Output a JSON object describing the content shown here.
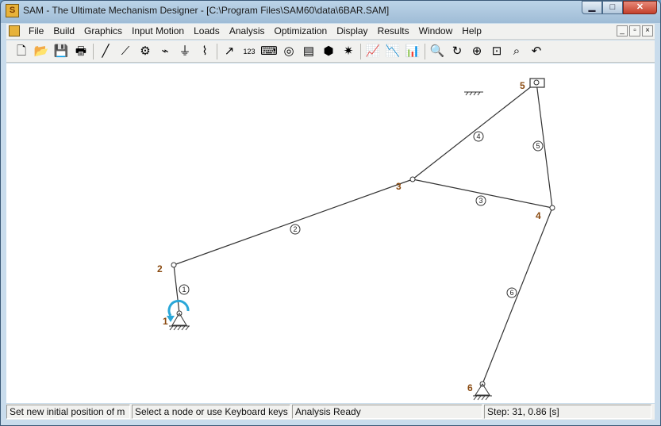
{
  "window": {
    "title": "SAM - The Ultimate Mechanism Designer - [C:\\Program Files\\SAM60\\data\\6BAR.SAM]",
    "app_icon": "sam-app-icon",
    "controls": {
      "minimize": "▁",
      "maximize": "□",
      "close": "✕"
    }
  },
  "menu": {
    "items": [
      "File",
      "Build",
      "Graphics",
      "Input Motion",
      "Loads",
      "Analysis",
      "Optimization",
      "Display",
      "Results",
      "Window",
      "Help"
    ],
    "mdi_controls": [
      "_",
      "▫",
      "×"
    ]
  },
  "toolbar": {
    "icons": [
      {
        "name": "new-icon",
        "glyph": "🗋"
      },
      {
        "name": "open-icon",
        "glyph": "📂"
      },
      {
        "name": "save-icon",
        "glyph": "💾"
      },
      {
        "name": "print-icon",
        "glyph": "🖶"
      },
      {
        "name": "link-icon",
        "glyph": "╱"
      },
      {
        "name": "slider-icon",
        "glyph": "⟋"
      },
      {
        "name": "gear-icon",
        "glyph": "⚙"
      },
      {
        "name": "belt-icon",
        "glyph": "⌁"
      },
      {
        "name": "ground-icon",
        "glyph": "⏚"
      },
      {
        "name": "spring-icon",
        "glyph": "⌇"
      },
      {
        "name": "motion-icon",
        "glyph": "↗"
      },
      {
        "name": "numbering-icon",
        "glyph": "123"
      },
      {
        "name": "keyboard-icon",
        "glyph": "⌨"
      },
      {
        "name": "trace-icon",
        "glyph": "◎"
      },
      {
        "name": "chart-table-icon",
        "glyph": "▤"
      },
      {
        "name": "force-icon",
        "glyph": "⬢"
      },
      {
        "name": "analysis-icon",
        "glyph": "✷"
      },
      {
        "name": "graph-1-icon",
        "glyph": "📈"
      },
      {
        "name": "graph-2-icon",
        "glyph": "📉"
      },
      {
        "name": "graph-3-icon",
        "glyph": "📊"
      },
      {
        "name": "zoom-out-icon",
        "glyph": "🔍"
      },
      {
        "name": "rotate-icon",
        "glyph": "↻"
      },
      {
        "name": "zoom-in-icon",
        "glyph": "⊕"
      },
      {
        "name": "zoom-window-icon",
        "glyph": "⊡"
      },
      {
        "name": "zoom-fit-icon",
        "glyph": "⌕"
      },
      {
        "name": "undo-icon",
        "glyph": "↶"
      }
    ],
    "separators_after": [
      3,
      9,
      16,
      19
    ]
  },
  "mechanism": {
    "node_labels": [
      "1",
      "2",
      "3",
      "4",
      "5",
      "6"
    ],
    "link_labels": [
      "1",
      "2",
      "3",
      "4",
      "5",
      "6"
    ],
    "colors": {
      "links": "#333333",
      "node_labels": "#8a4a10",
      "input_arrow": "#2aa7d8"
    }
  },
  "status": {
    "hint": "Set new initial position of m",
    "instruction": "Select a node or use Keyboard keys",
    "state": "Analysis Ready",
    "step": "Step: 31,    0.86 [s]"
  }
}
